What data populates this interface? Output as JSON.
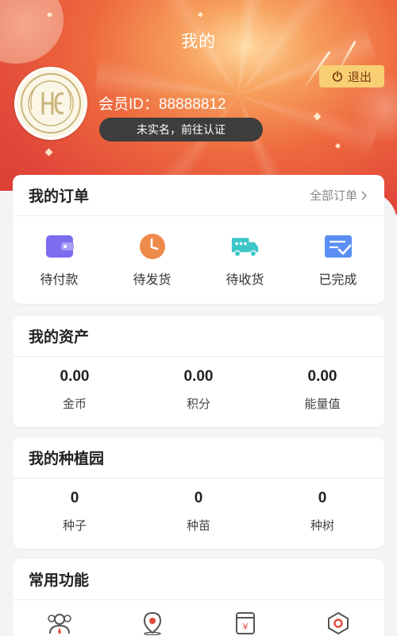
{
  "header": {
    "title": "我的",
    "logout_label": "退出",
    "member_id": "会员ID：88888812",
    "verify_label": "未实名，前往认证"
  },
  "orders": {
    "title": "我的订单",
    "all_label": "全部订单",
    "items": [
      {
        "label": "待付款",
        "icon": "wallet-icon",
        "color": "#7b6cf0"
      },
      {
        "label": "待发货",
        "icon": "clock-icon",
        "color": "#ee8a4a"
      },
      {
        "label": "待收货",
        "icon": "truck-icon",
        "color": "#3cc6c8"
      },
      {
        "label": "已完成",
        "icon": "completed-doc-icon",
        "color": "#5b8ff5"
      }
    ]
  },
  "assets": {
    "title": "我的资产",
    "items": [
      {
        "value": "0.00",
        "label": "金币"
      },
      {
        "value": "0.00",
        "label": "积分"
      },
      {
        "value": "0.00",
        "label": "能量值"
      }
    ]
  },
  "garden": {
    "title": "我的种植园",
    "items": [
      {
        "value": "0",
        "label": "种子"
      },
      {
        "value": "0",
        "label": "种苗"
      },
      {
        "value": "0",
        "label": "种树"
      }
    ]
  },
  "functions": {
    "title": "常用功能",
    "items": [
      {
        "icon": "team-icon"
      },
      {
        "icon": "location-icon"
      },
      {
        "icon": "yuan-jar-icon"
      },
      {
        "icon": "settings-hex-icon"
      }
    ]
  },
  "colors": {
    "header_red": "#e2493a",
    "logout_bg": "#f9cf74",
    "verify_bg": "#3d3d3d"
  }
}
